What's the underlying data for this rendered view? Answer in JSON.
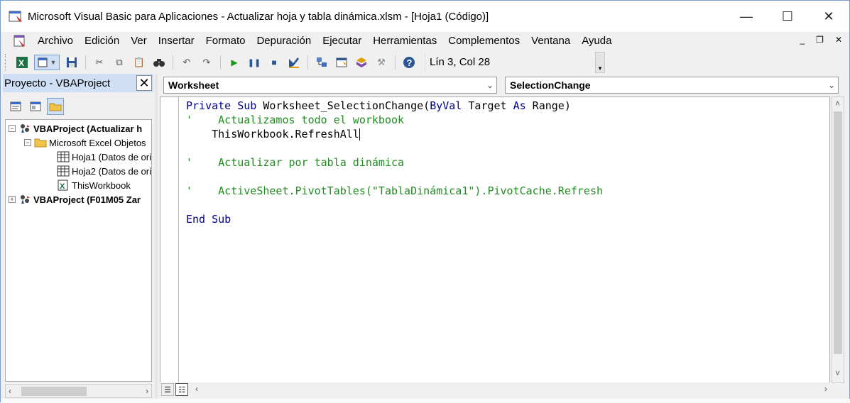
{
  "window": {
    "title": "Microsoft Visual Basic para Aplicaciones - Actualizar hoja y tabla dinámica.xlsm - [Hoja1 (Código)]",
    "controls": {
      "minimize": "—",
      "maximize": "☐",
      "close": "✕"
    }
  },
  "menu": {
    "items": [
      "Archivo",
      "Edición",
      "Ver",
      "Insertar",
      "Formato",
      "Depuración",
      "Ejecutar",
      "Herramientas",
      "Complementos",
      "Ventana",
      "Ayuda"
    ],
    "mdi": {
      "minimize": "_",
      "restore": "❐",
      "close": "✕"
    }
  },
  "toolbar": {
    "position": "Lín 3, Col 28",
    "icons": [
      "excel-view-icon",
      "insert-module-icon",
      "save-icon",
      "cut-icon",
      "copy-icon",
      "paste-icon",
      "find-icon",
      "undo-icon",
      "redo-icon",
      "run-icon",
      "break-icon",
      "reset-icon",
      "design-mode-icon",
      "project-explorer-icon",
      "properties-icon",
      "object-browser-icon",
      "toolbox-icon",
      "help-icon"
    ]
  },
  "project": {
    "title": "Proyecto - VBAProject",
    "tree": [
      {
        "label": "VBAProject (Actualizar h",
        "level": 0,
        "bold": true,
        "expander": "−"
      },
      {
        "label": "Microsoft Excel Objetos",
        "level": 1,
        "bold": false,
        "expander": "−"
      },
      {
        "label": "Hoja1 (Datos de ori",
        "level": 2,
        "bold": false,
        "expander": ""
      },
      {
        "label": "Hoja2 (Datos de ori",
        "level": 2,
        "bold": false,
        "expander": ""
      },
      {
        "label": "ThisWorkbook",
        "level": 2,
        "bold": false,
        "expander": ""
      },
      {
        "label": "VBAProject (F01M05 Zar",
        "level": 0,
        "bold": true,
        "expander": "+"
      }
    ]
  },
  "code": {
    "object_combo": "Worksheet",
    "proc_combo": "SelectionChange",
    "lines": [
      {
        "segments": [
          {
            "t": "Private Sub ",
            "c": "kw"
          },
          {
            "t": "Worksheet_SelectionChange(",
            "c": "tx"
          },
          {
            "t": "ByVal",
            "c": "kw"
          },
          {
            "t": " Target ",
            "c": "tx"
          },
          {
            "t": "As",
            "c": "kw"
          },
          {
            "t": " Range)",
            "c": "tx"
          }
        ]
      },
      {
        "segments": [
          {
            "t": "'    Actualizamos todo el workbook",
            "c": "cm"
          }
        ]
      },
      {
        "segments": [
          {
            "t": "    ThisWorkbook.RefreshAll",
            "c": "tx"
          }
        ],
        "caret": true
      },
      {
        "segments": [
          {
            "t": "",
            "c": "tx"
          }
        ]
      },
      {
        "segments": [
          {
            "t": "'    Actualizar por tabla dinámica",
            "c": "cm"
          }
        ]
      },
      {
        "segments": [
          {
            "t": "",
            "c": "tx"
          }
        ]
      },
      {
        "segments": [
          {
            "t": "'    ActiveSheet.PivotTables(\"TablaDinámica1\").PivotCache.Refresh",
            "c": "cm"
          }
        ]
      },
      {
        "segments": [
          {
            "t": "",
            "c": "tx"
          }
        ]
      },
      {
        "segments": [
          {
            "t": "End Sub",
            "c": "kw"
          }
        ]
      }
    ]
  },
  "colors": {
    "keyword": "#00008b",
    "comment": "#228b22",
    "panel_title_bg": "#cfe0f6"
  }
}
